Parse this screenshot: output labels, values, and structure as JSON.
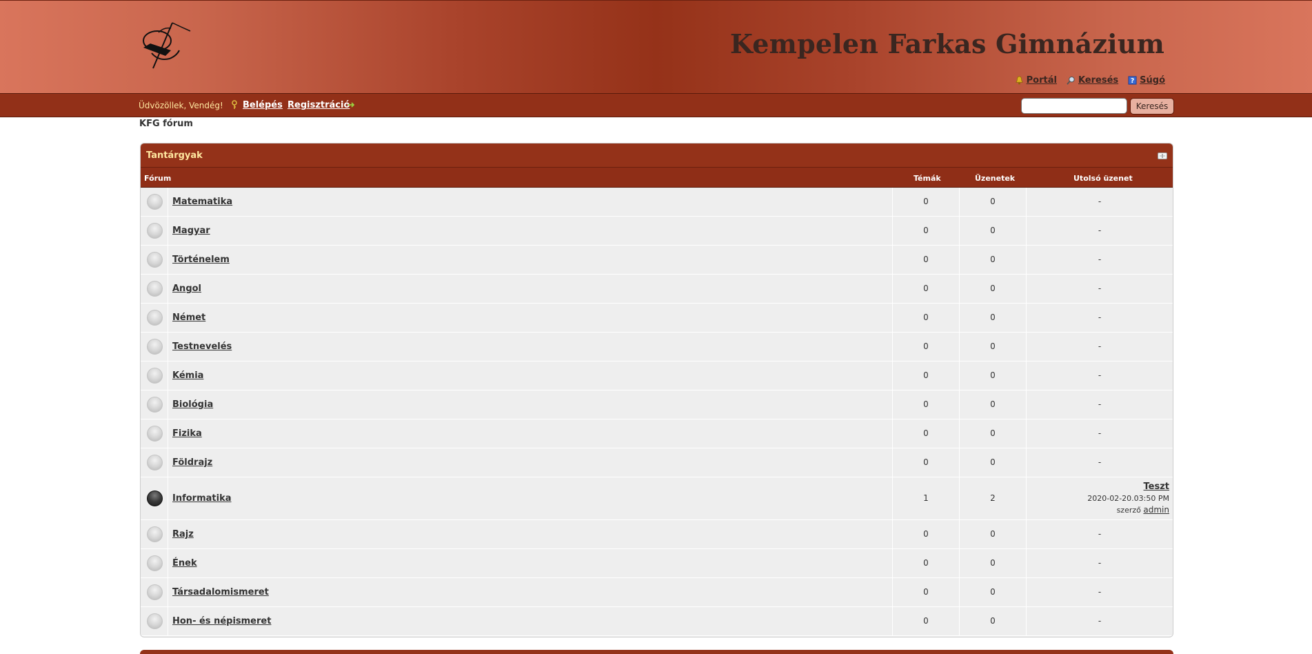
{
  "header": {
    "site_title": "Kempelen Farkas Gimnázium",
    "links": [
      {
        "label": "Portál",
        "icon": "bell-icon"
      },
      {
        "label": "Keresés",
        "icon": "magnifier-icon"
      },
      {
        "label": "Súgó",
        "icon": "help-book-icon"
      }
    ]
  },
  "navbar": {
    "welcome": "Üdvözöllek, Vendég!",
    "login": "Belépés",
    "register": "Regisztráció",
    "search_placeholder": "",
    "search_button": "Keresés"
  },
  "breadcrumb": "KFG fórum",
  "category": {
    "title": "Tantárgyak",
    "columns": {
      "forum": "Fórum",
      "topics": "Témák",
      "posts": "Üzenetek",
      "last_post": "Utolsó üzenet"
    },
    "forums": [
      {
        "name": "Matematika",
        "topics": "0",
        "posts": "0",
        "last": "-",
        "unread": false
      },
      {
        "name": "Magyar",
        "topics": "0",
        "posts": "0",
        "last": "-",
        "unread": false
      },
      {
        "name": "Történelem",
        "topics": "0",
        "posts": "0",
        "last": "-",
        "unread": false
      },
      {
        "name": "Angol",
        "topics": "0",
        "posts": "0",
        "last": "-",
        "unread": false
      },
      {
        "name": "Német",
        "topics": "0",
        "posts": "0",
        "last": "-",
        "unread": false
      },
      {
        "name": "Testnevelés",
        "topics": "0",
        "posts": "0",
        "last": "-",
        "unread": false
      },
      {
        "name": "Kémia",
        "topics": "0",
        "posts": "0",
        "last": "-",
        "unread": false
      },
      {
        "name": "Biológia",
        "topics": "0",
        "posts": "0",
        "last": "-",
        "unread": false
      },
      {
        "name": "Fizika",
        "topics": "0",
        "posts": "0",
        "last": "-",
        "unread": false
      },
      {
        "name": "Földrajz",
        "topics": "0",
        "posts": "0",
        "last": "-",
        "unread": false
      },
      {
        "name": "Informatika",
        "topics": "1",
        "posts": "2",
        "last": "",
        "unread": true,
        "last_topic": "Teszt",
        "last_date": "2020-02-20.03:50 PM",
        "last_by_prefix": "szerző",
        "last_by_user": "admin"
      },
      {
        "name": "Rajz",
        "topics": "0",
        "posts": "0",
        "last": "-",
        "unread": false
      },
      {
        "name": "Ének",
        "topics": "0",
        "posts": "0",
        "last": "-",
        "unread": false
      },
      {
        "name": "Társadalomismeret",
        "topics": "0",
        "posts": "0",
        "last": "-",
        "unread": false
      },
      {
        "name": "Hon- és népismeret",
        "topics": "0",
        "posts": "0",
        "last": "-",
        "unread": false
      }
    ]
  },
  "colors": {
    "header_dark": "#953219",
    "navbar": "#923018",
    "title_text": "#3a2620",
    "cat_title": "#ffe8a0"
  }
}
